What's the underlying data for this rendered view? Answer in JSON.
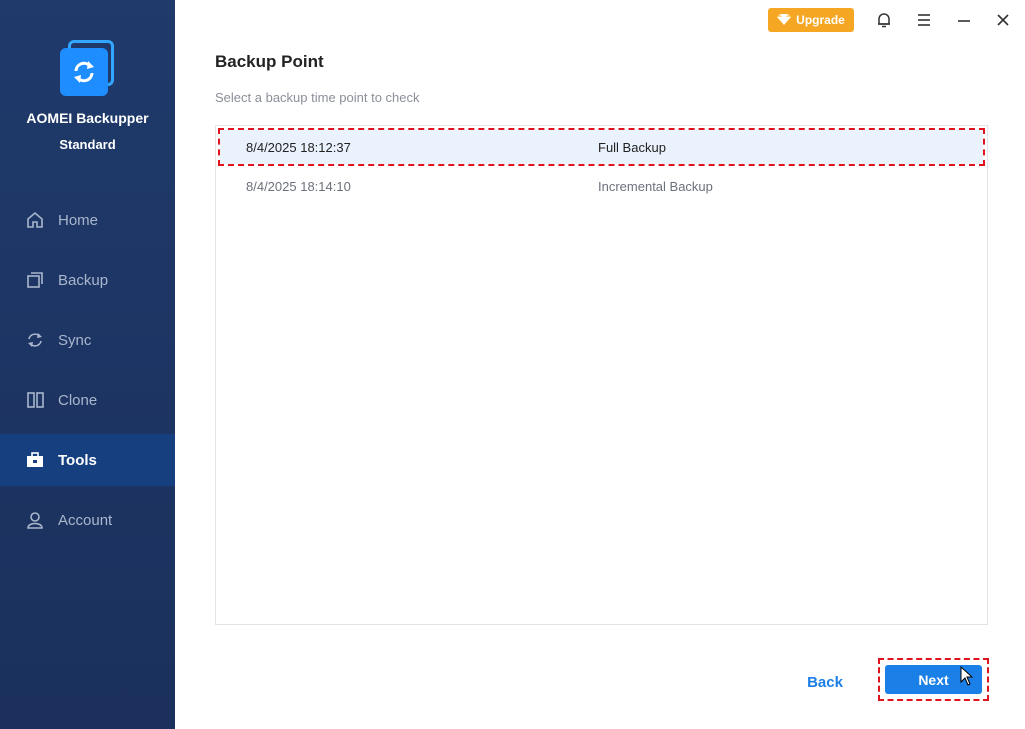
{
  "app": {
    "name": "AOMEI Backupper",
    "edition": "Standard"
  },
  "sidebar": {
    "items": [
      {
        "label": "Home",
        "icon": "home-icon",
        "active": false
      },
      {
        "label": "Backup",
        "icon": "backup-icon",
        "active": false
      },
      {
        "label": "Sync",
        "icon": "sync-icon",
        "active": false
      },
      {
        "label": "Clone",
        "icon": "clone-icon",
        "active": false
      },
      {
        "label": "Tools",
        "icon": "toolbox-icon",
        "active": true
      },
      {
        "label": "Account",
        "icon": "user-icon",
        "active": false
      }
    ]
  },
  "topbar": {
    "upgrade_label": "Upgrade",
    "icons": [
      "diamond-icon",
      "bell-icon",
      "menu-icon",
      "minimize-icon",
      "close-icon"
    ]
  },
  "main": {
    "title": "Backup Point",
    "subtitle": "Select a backup time point to check",
    "rows": [
      {
        "time": "8/4/2025 18:12:37",
        "type": "Full Backup",
        "selected": true
      },
      {
        "time": "8/4/2025 18:14:10",
        "type": "Incremental Backup",
        "selected": false
      }
    ]
  },
  "footer": {
    "back_label": "Back",
    "next_label": "Next"
  },
  "colors": {
    "sidebar_bg": "#1f3a6b",
    "active_bg": "#163f80",
    "accent": "#1a7fe6",
    "upgrade": "#f5a623",
    "highlight_dash": "#e0141e"
  }
}
